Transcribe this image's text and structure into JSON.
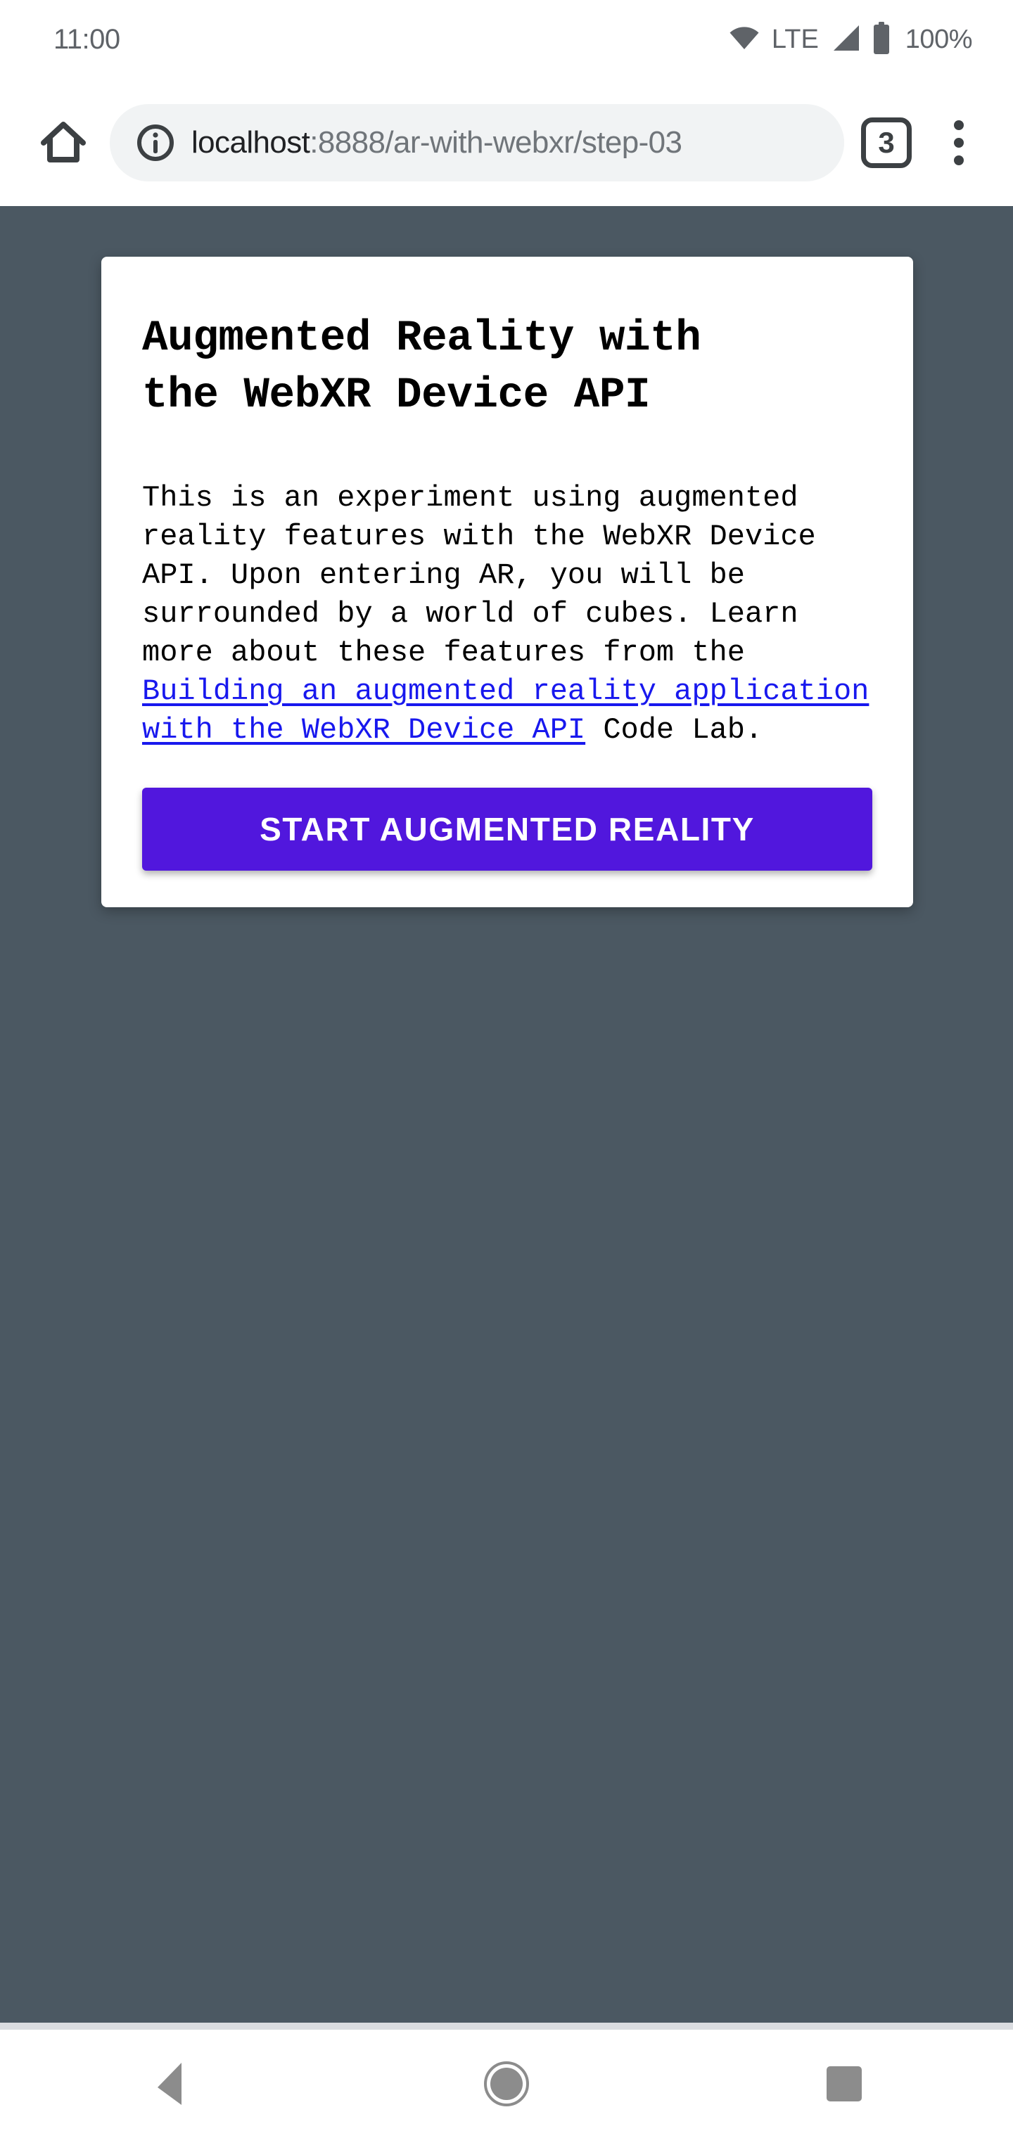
{
  "status_bar": {
    "clock": "11:00",
    "wifi_icon": "wifi-icon",
    "network_label": "LTE",
    "signal_icon": "cellular-signal-icon",
    "battery_icon": "battery-full-icon",
    "battery_label": "100%"
  },
  "browser": {
    "home_icon": "home-icon",
    "site_info_icon": "info-circle-icon",
    "url_host": "localhost",
    "url_rest": ":8888/ar-with-webxr/step-03",
    "url_full": "localhost:8888/ar-with-webxr/step-03",
    "tab_count": "3",
    "overflow_icon": "more-vertical-icon"
  },
  "page": {
    "background_color": "#4b5862",
    "card": {
      "title": "Augmented Reality with\nthe WebXR Device API",
      "body_before_link": "This is an experiment using augmented reality features with the WebXR Device API. Upon entering AR, you will be surrounded by a world of cubes. Learn more about these features from the ",
      "link_text": "Building an augmented reality application with the WebXR Device API",
      "body_after_link": " Code Lab.",
      "link_color": "#1818ee",
      "button_label": "START AUGMENTED REALITY",
      "button_color": "#5117dd"
    }
  },
  "navbar": {
    "back_icon": "back-triangle-icon",
    "home_icon": "home-circle-icon",
    "recents_icon": "recents-square-icon"
  }
}
